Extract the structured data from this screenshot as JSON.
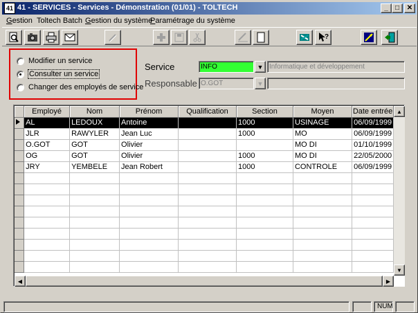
{
  "window": {
    "icon_label": "41",
    "title": "41 - SERVICES - Services - Démonstration (01/01) - TOLTECH"
  },
  "menu": {
    "items": [
      {
        "prefix": "",
        "key": "G",
        "rest": "estion"
      },
      {
        "prefix": "Toltech Batch",
        "key": "",
        "rest": ""
      },
      {
        "prefix": "",
        "key": "G",
        "rest": "estion du système"
      },
      {
        "prefix": "",
        "key": "P",
        "rest": "aramétrage du système"
      }
    ]
  },
  "radios": {
    "option1": "Modifier un service",
    "option2": "Consulter un service",
    "option3": "Changer des employés de service",
    "selected": "option2"
  },
  "form": {
    "service_label": "Service",
    "service_value": "INFO",
    "service_desc": "Informatique et développement",
    "responsable_label": "Responsable",
    "responsable_value": "O.GOT",
    "responsable_desc": ""
  },
  "grid": {
    "columns": [
      "Employé",
      "Nom",
      "Prénom",
      "Qualification",
      "Section",
      "Moyen",
      "Date entrée"
    ],
    "rows": [
      [
        "AL",
        "LEDOUX",
        "Antoine",
        "",
        "1000",
        "USINAGE",
        "06/09/1999"
      ],
      [
        "JLR",
        "RAWYLER",
        "Jean Luc",
        "",
        "1000",
        "MO",
        "06/09/1999"
      ],
      [
        "O.GOT",
        "GOT",
        "Olivier",
        "",
        "",
        "MO DI",
        "01/10/1999"
      ],
      [
        "OG",
        "GOT",
        "Olivier",
        "",
        "1000",
        "MO DI",
        "22/05/2000"
      ],
      [
        "JRY",
        "YEMBELE",
        "Jean Robert",
        "",
        "1000",
        "CONTROLE",
        "06/09/1999"
      ]
    ],
    "selected_row": 0,
    "total_rows": 14
  },
  "status": {
    "num": "NUM"
  },
  "colors": {
    "accent_green": "#33ff33",
    "highlight_red": "#e00000",
    "title_start": "#0a246a",
    "title_end": "#a6caf0"
  }
}
